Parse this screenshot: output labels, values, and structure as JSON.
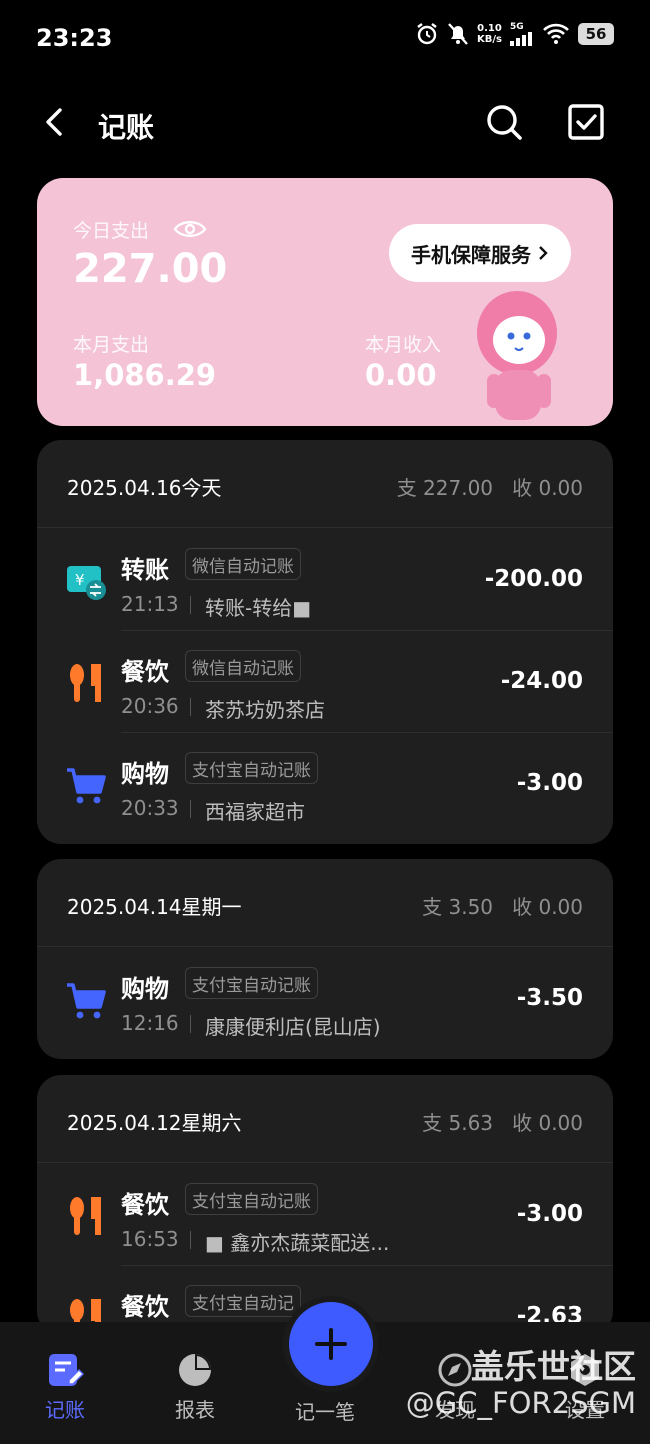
{
  "status_bar": {
    "time": "23:23",
    "net_speed": "0.10",
    "net_unit": "KB/s",
    "network": "5G",
    "battery": "56"
  },
  "header": {
    "title": "记账"
  },
  "summary": {
    "today_label": "今日支出",
    "today_value": "227.00",
    "month_expense_label": "本月支出",
    "month_expense_value": "1,086.29",
    "month_income_label": "本月收入",
    "month_income_value": "0.00",
    "service_button": "手机保障服务"
  },
  "days": [
    {
      "date": "2025.04.16今天",
      "expense": "支 227.00",
      "income": "收 0.00",
      "transactions": [
        {
          "category": "转账",
          "tag": "微信自动记账",
          "time": "21:13",
          "desc": "转账-转给■",
          "amount": "-200.00",
          "icon": "transfer-icon"
        },
        {
          "category": "餐饮",
          "tag": "微信自动记账",
          "time": "20:36",
          "desc": "茶苏坊奶茶店",
          "amount": "-24.00",
          "icon": "dining-icon"
        },
        {
          "category": "购物",
          "tag": "支付宝自动记账",
          "time": "20:33",
          "desc": "西福家超市",
          "amount": "-3.00",
          "icon": "cart-icon"
        }
      ]
    },
    {
      "date": "2025.04.14星期一",
      "expense": "支 3.50",
      "income": "收 0.00",
      "transactions": [
        {
          "category": "购物",
          "tag": "支付宝自动记账",
          "time": "12:16",
          "desc": "康康便利店(昆山店)",
          "amount": "-3.50",
          "icon": "cart-icon"
        }
      ]
    },
    {
      "date": "2025.04.12星期六",
      "expense": "支 5.63",
      "income": "收 0.00",
      "transactions": [
        {
          "category": "餐饮",
          "tag": "支付宝自动记账",
          "time": "16:53",
          "desc": "■ 鑫亦杰蔬菜配送...",
          "amount": "-3.00",
          "icon": "dining-icon"
        },
        {
          "category": "餐饮",
          "tag": "支付宝自动记",
          "time": "",
          "desc": "",
          "amount": "-2.63",
          "icon": "dining-icon"
        }
      ]
    }
  ],
  "nav": {
    "items": [
      {
        "label": "记账",
        "active": true
      },
      {
        "label": "报表",
        "active": false
      },
      {
        "label": "记一笔",
        "active": false
      },
      {
        "label": "发现",
        "active": false
      },
      {
        "label": "设置",
        "active": false
      }
    ]
  },
  "watermark": {
    "line1": "盖乐世社区",
    "line2": "@GC_FOR2SGM"
  },
  "colors": {
    "accent": "#3d5bff",
    "card_pink": "#f4c3d6",
    "dining_orange": "#ff7a2a",
    "cart_blue": "#4466ff",
    "transfer_teal": "#21c1c6"
  }
}
